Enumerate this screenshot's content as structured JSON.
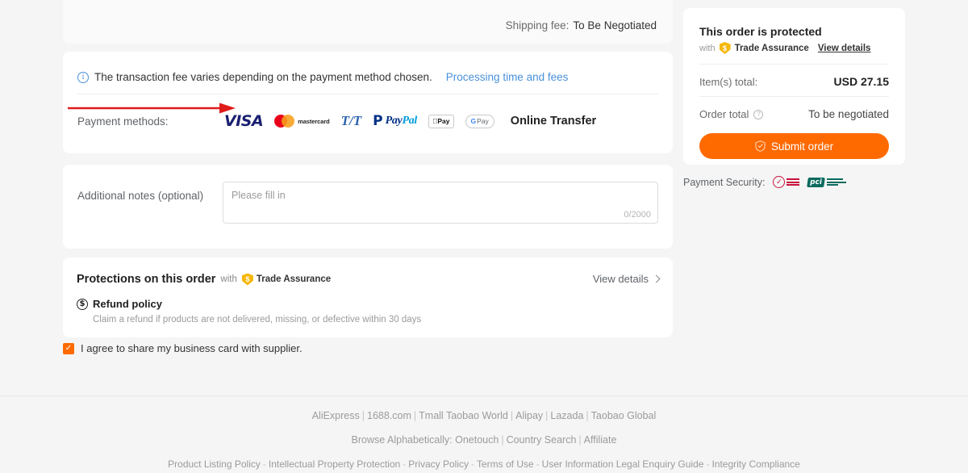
{
  "shipping": {
    "label": "Shipping fee:",
    "value": "To Be Negotiated"
  },
  "payment": {
    "fee_note": "The transaction fee varies depending on the payment method chosen.",
    "fee_link": "Processing time and fees",
    "methods_label": "Payment methods:",
    "methods": [
      {
        "name": "visa",
        "label": "VISA"
      },
      {
        "name": "mastercard",
        "label": "mastercard"
      },
      {
        "name": "tt",
        "label": "T/T"
      },
      {
        "name": "paypal",
        "label_a": "Pay",
        "label_b": "Pal"
      },
      {
        "name": "applepay",
        "label": "Pay"
      },
      {
        "name": "googlepay",
        "label_g": "G",
        "label": "Pay"
      }
    ],
    "online_transfer": "Online Transfer"
  },
  "notes": {
    "label": "Additional notes (optional)",
    "placeholder": "Please fill in",
    "value": "",
    "counter": "0/2000"
  },
  "protections": {
    "title": "Protections on this order",
    "with": "with",
    "trade_assurance": "Trade Assurance",
    "view_details": "View details",
    "refund_title": "Refund policy",
    "refund_desc": "Claim a refund if products are not delivered, missing, or defective within 30 days"
  },
  "agree": {
    "text": "I agree to share my business card with supplier.",
    "checked": true,
    "check_glyph": "✓"
  },
  "summary": {
    "title": "This order is protected",
    "with": "with",
    "trade_assurance": "Trade Assurance",
    "view_details": "View details",
    "items_total_label": "Item(s) total:",
    "items_total_value": "USD 27.15",
    "order_total_label": "Order total",
    "order_total_value": "To be negotiated",
    "submit_label": "Submit order"
  },
  "payment_security": {
    "label": "Payment Security:",
    "badges": [
      "norton-secured-badge",
      "pci-compliant-badge"
    ]
  },
  "footer": {
    "line1": [
      "AliExpress",
      "1688.com",
      "Tmall Taobao World",
      "Alipay",
      "Lazada",
      "Taobao Global"
    ],
    "line2_prefix": "Browse Alphabetically:",
    "line2": [
      "Onetouch",
      "Country Search",
      "Affiliate"
    ],
    "line3": [
      "Product Listing Policy",
      "Intellectual Property Protection",
      "Privacy Policy",
      "Terms of Use",
      "User Information Legal Enquiry Guide",
      "Integrity Compliance"
    ]
  },
  "annotation": {
    "arrow_color": "#e01b1b",
    "points_to": "payment-methods-row"
  },
  "colors": {
    "accent": "#ff6a00",
    "link": "#4a90d9",
    "page_bg": "#f5f5f5",
    "trade_assurance": "#f5b70a"
  },
  "icons": {
    "info": "i",
    "dollar": "$",
    "question": "?",
    "shield_dollar": "$",
    "norton_check": "✓",
    "pci": "pci"
  }
}
